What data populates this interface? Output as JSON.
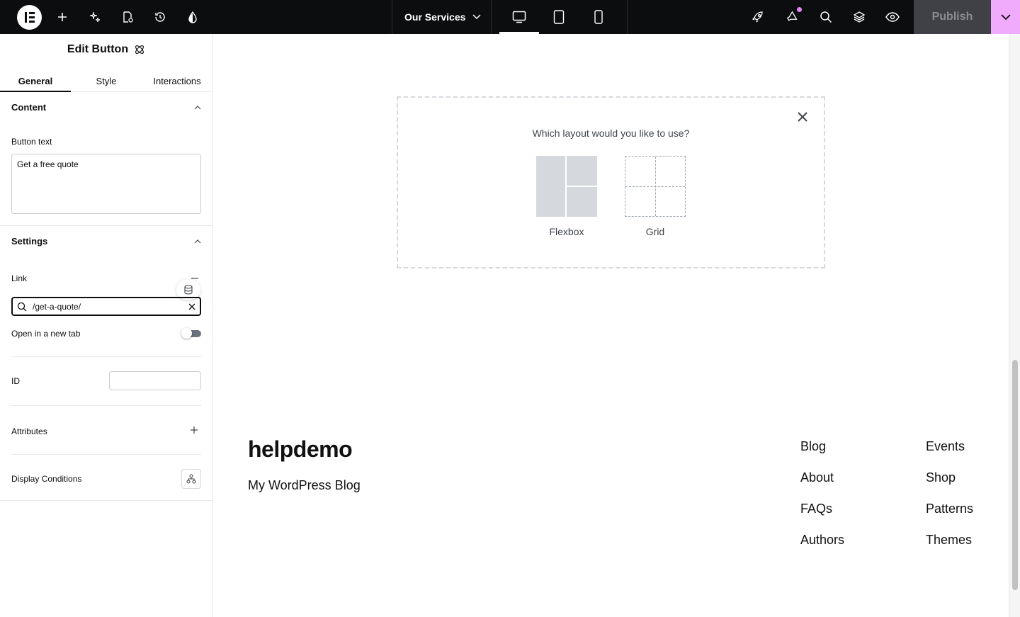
{
  "topbar": {
    "page_name": "Our Services",
    "publish_label": "Publish",
    "icons": [
      "elementor-logo-icon",
      "add-element-icon",
      "ai-sparkle-icon",
      "page-settings-icon",
      "history-icon",
      "site-settings-icon",
      "chevron-down-icon",
      "desktop-icon",
      "tablet-icon",
      "mobile-icon",
      "rocket-icon",
      "whats-new-icon",
      "search-icon",
      "structure-icon",
      "preview-icon"
    ],
    "notification_color": "#e884f5",
    "accent_color": "#f0abfc"
  },
  "panel": {
    "title": "Edit Button",
    "tabs": [
      {
        "label": "General",
        "active": true
      },
      {
        "label": "Style",
        "active": false
      },
      {
        "label": "Interactions",
        "active": false
      }
    ],
    "content_section": {
      "title": "Content",
      "button_text_label": "Button text",
      "button_text_value": "Get a free quote"
    },
    "settings_section": {
      "title": "Settings",
      "link_label": "Link",
      "link_value": "/get-a-quote/",
      "new_tab_label": "Open in a new tab",
      "new_tab_on": false,
      "id_label": "ID",
      "id_value": "",
      "attributes_label": "Attributes",
      "display_conditions_label": "Display Conditions"
    }
  },
  "canvas": {
    "layout_prompt": "Which layout would you like to use?",
    "layout_options": [
      "Flexbox",
      "Grid"
    ],
    "site_title": "helpdemo",
    "site_tagline": "My WordPress Blog",
    "footer_links_col1": [
      "Blog",
      "About",
      "FAQs",
      "Authors"
    ],
    "footer_links_col2": [
      "Events",
      "Shop",
      "Patterns",
      "Themes"
    ]
  }
}
